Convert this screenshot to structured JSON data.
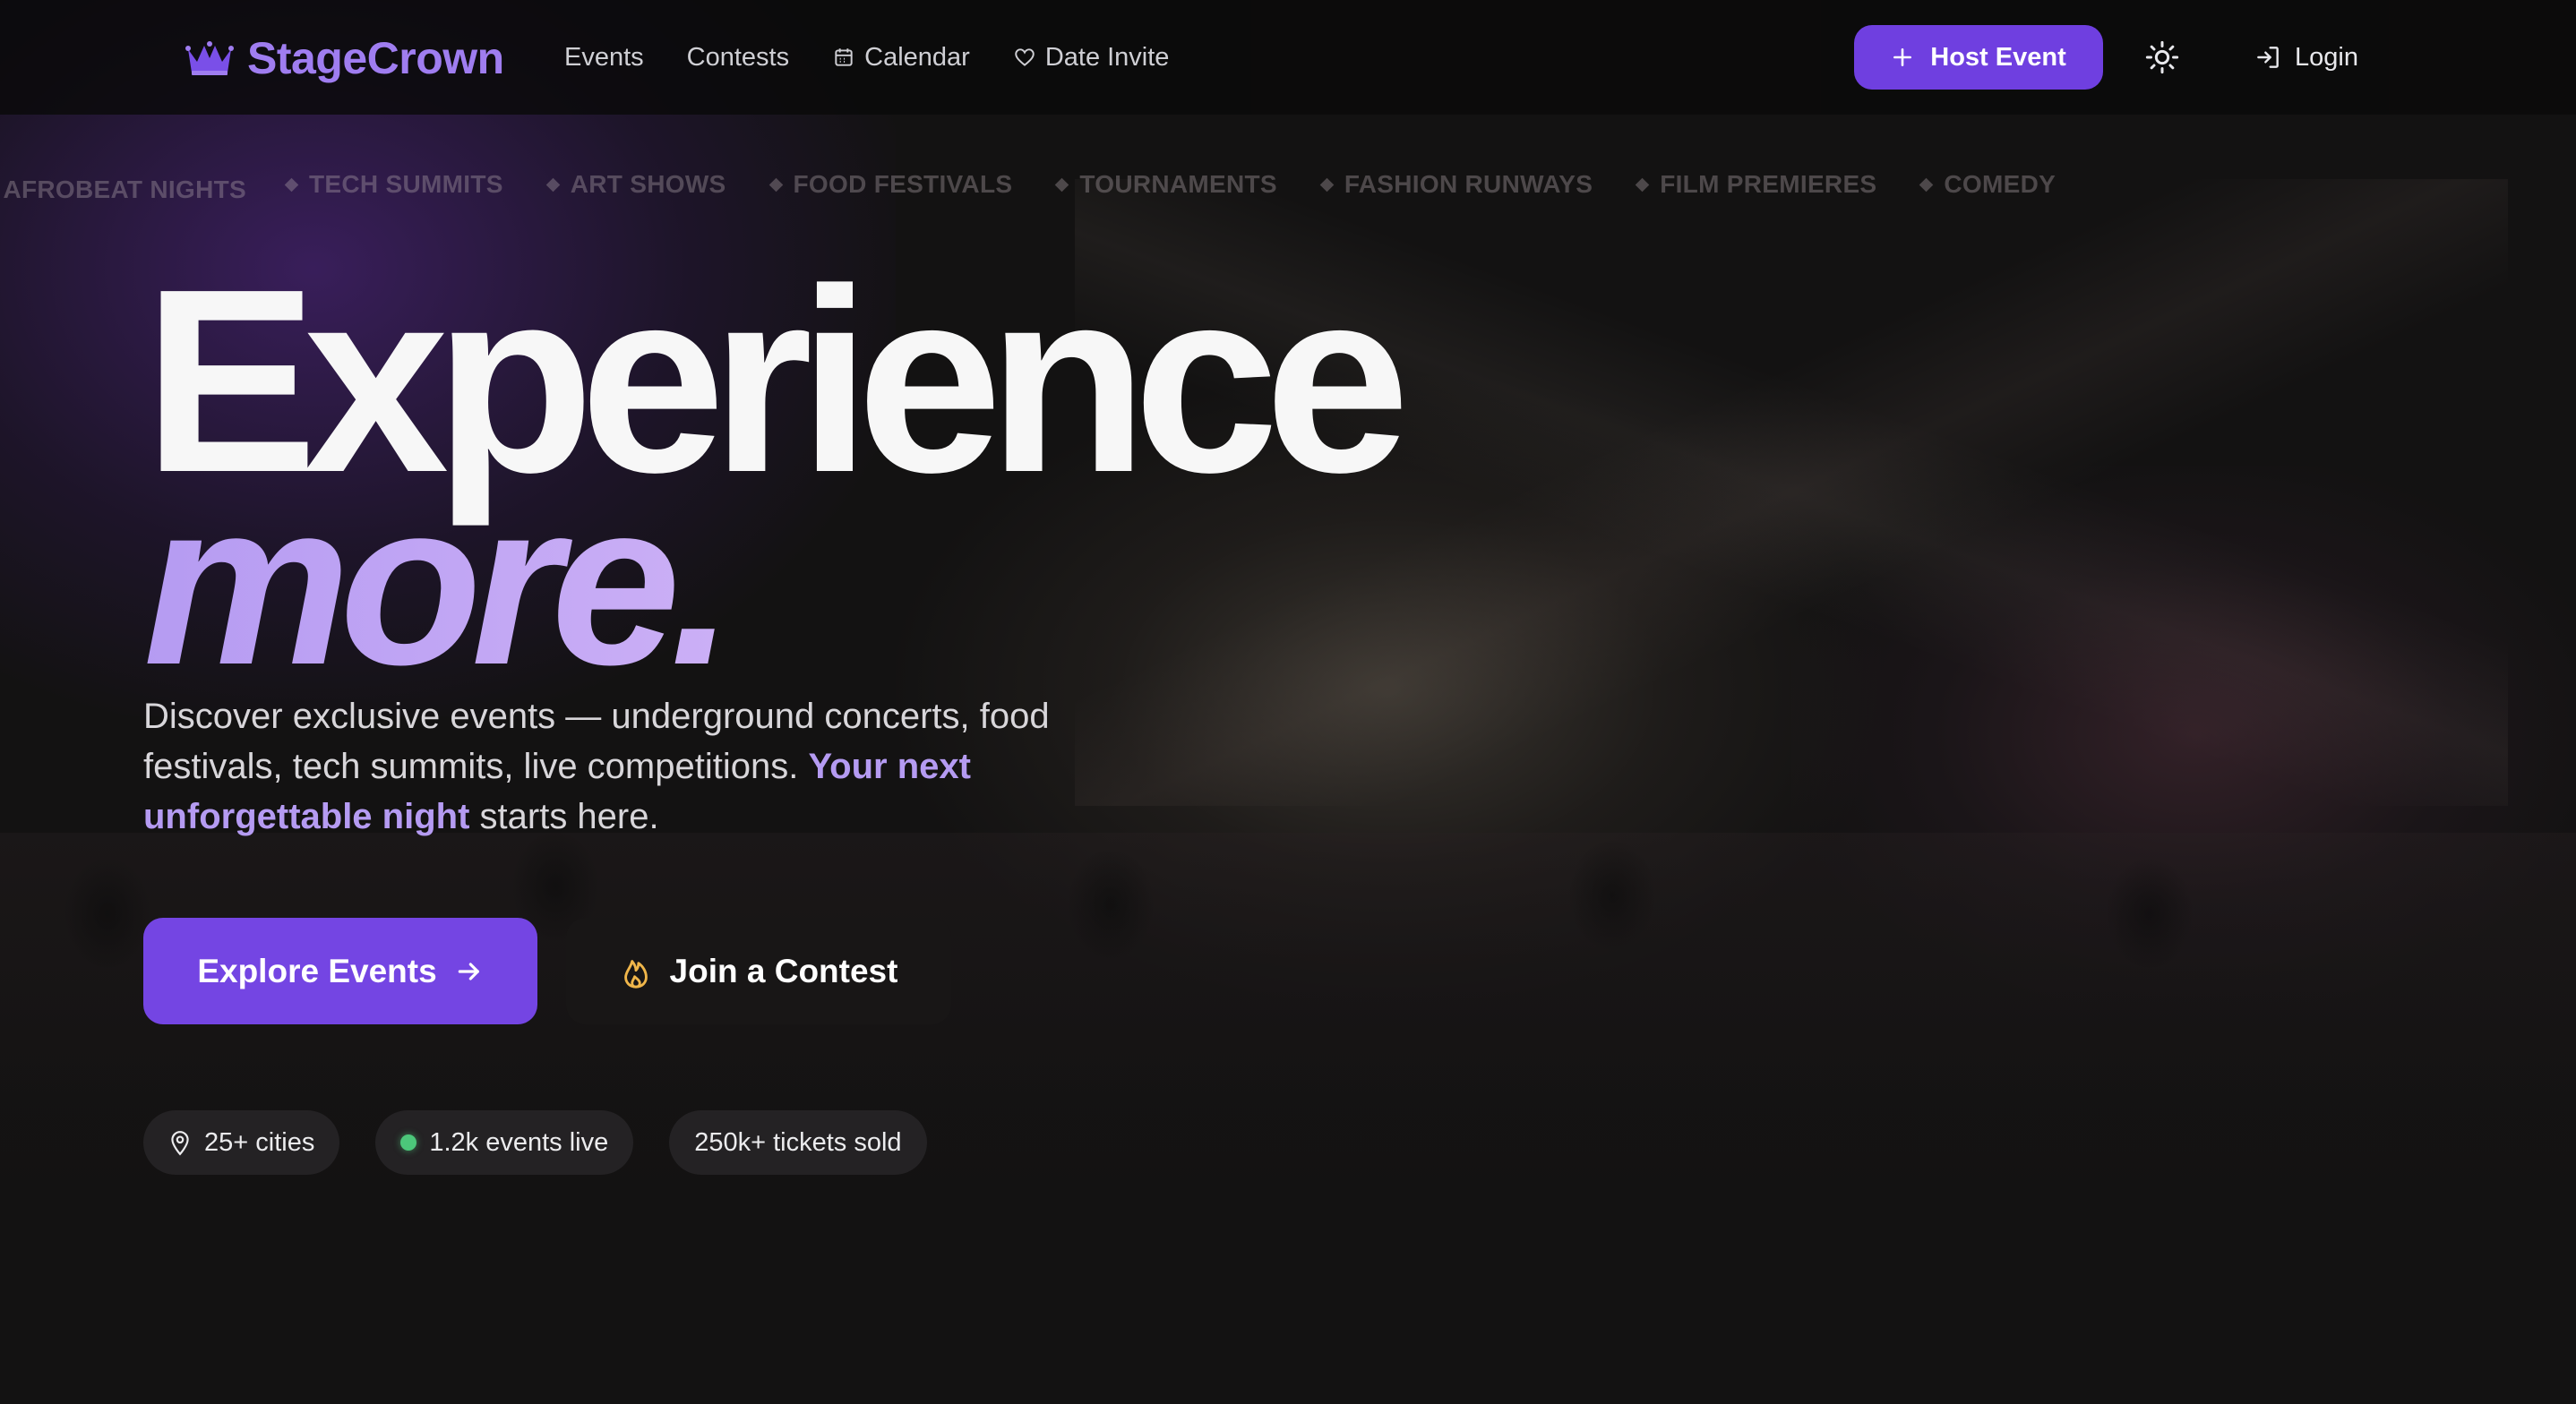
{
  "brand": {
    "name": "StageCrown",
    "icon": "crown-icon",
    "color": "#9f7df0"
  },
  "nav": {
    "items": [
      {
        "label": "Events",
        "icon": ""
      },
      {
        "label": "Contests",
        "icon": ""
      },
      {
        "label": "Calendar",
        "icon": "calendar-icon"
      },
      {
        "label": "Date Invite",
        "icon": "heart-icon"
      }
    ]
  },
  "actions": {
    "host_event_label": "Host Event",
    "theme_toggle_icon": "sun-icon",
    "login_label": "Login"
  },
  "marquee": {
    "partial_first": "AFROBEAT NIGHTS",
    "items": [
      "TECH SUMMITS",
      "ART SHOWS",
      "FOOD FESTIVALS",
      "TOURNAMENTS",
      "FASHION RUNWAYS",
      "FILM PREMIERES",
      "COMEDY"
    ]
  },
  "hero": {
    "line1": "Experience",
    "line2": "more.",
    "description_prefix": "Discover exclusive events — underground concerts, food festivals, tech summits, live competitions. ",
    "description_highlight": "Your next unforgettable night",
    "description_suffix": " starts here.",
    "primary_cta": "Explore Events",
    "secondary_cta": "Join a Contest"
  },
  "stats": [
    {
      "label": "25+ cities",
      "icon": "map-pin-icon"
    },
    {
      "label": "1.2k events live",
      "icon": "live-dot"
    },
    {
      "label": "250k+ tickets sold",
      "icon": ""
    }
  ],
  "colors": {
    "accent": "#7445e3",
    "accent_light": "#b59bf2",
    "background": "#131212",
    "live_green": "#4cc77a",
    "flame": "#f0b64a"
  }
}
